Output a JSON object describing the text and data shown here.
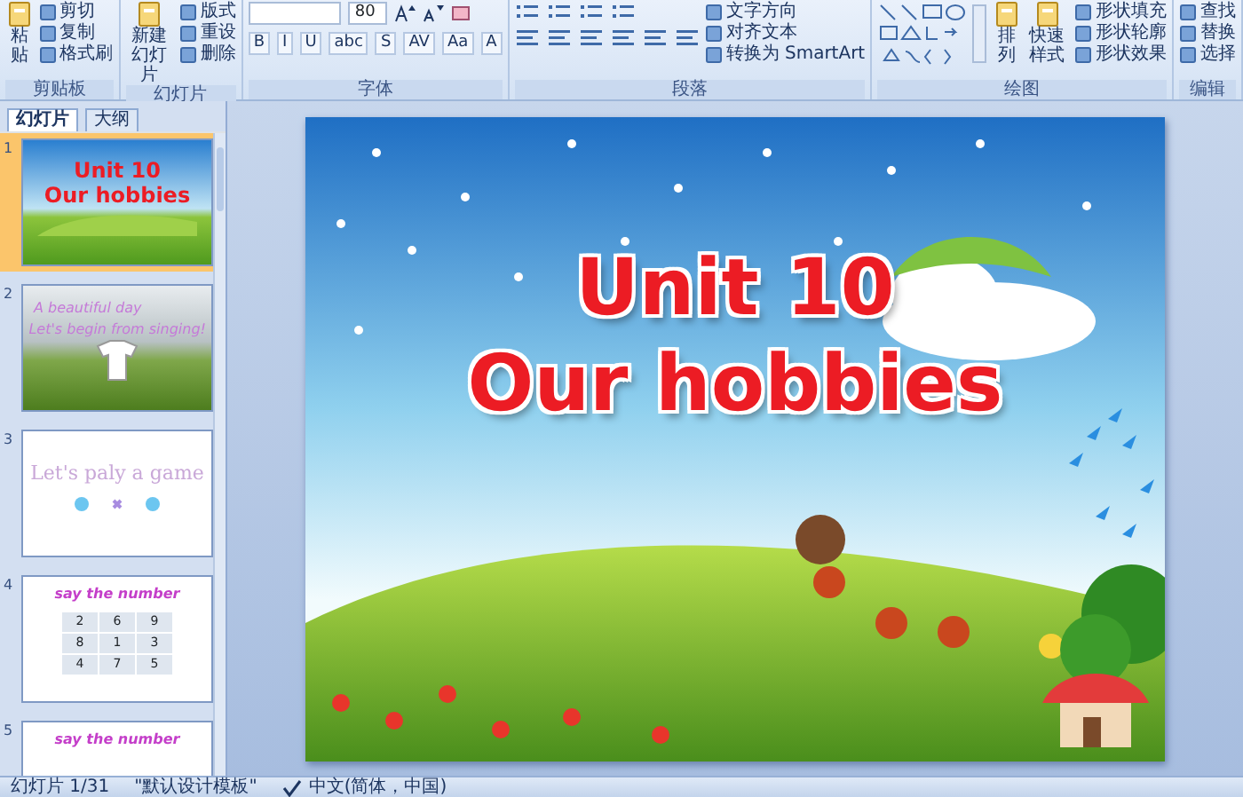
{
  "ribbon": {
    "groups": [
      {
        "label": "剪贴板",
        "columns": [
          [
            {
              "kind": "large",
              "label": "粘贴"
            }
          ],
          [
            {
              "kind": "small",
              "label": "剪切"
            },
            {
              "kind": "small",
              "label": "复制"
            },
            {
              "kind": "small",
              "label": "格式刷"
            }
          ]
        ]
      },
      {
        "label": "幻灯片",
        "columns": [
          [
            {
              "kind": "large",
              "label": "新建幻灯片"
            }
          ],
          [
            {
              "kind": "small",
              "label": "版式"
            },
            {
              "kind": "small",
              "label": "重设"
            },
            {
              "kind": "small",
              "label": "删除"
            }
          ]
        ]
      },
      {
        "label": "字体",
        "columns": [
          [
            {
              "kind": "fontbox",
              "size": "80"
            },
            {
              "kind": "glyphs",
              "glyphs": [
                "B",
                "I",
                "U",
                "abc",
                "S",
                "AV",
                "Aa",
                "A"
              ]
            }
          ]
        ]
      },
      {
        "label": "段落",
        "columns": [
          [
            {
              "kind": "list_icons"
            },
            {
              "kind": "align_icons"
            }
          ],
          [
            {
              "kind": "small",
              "label": "文字方向"
            },
            {
              "kind": "small",
              "label": "对齐文本"
            },
            {
              "kind": "small",
              "label": "转换为 SmartArt"
            }
          ]
        ]
      },
      {
        "label": "绘图",
        "columns": [
          [
            {
              "kind": "shapes"
            }
          ],
          [
            {
              "kind": "large",
              "label": "排列"
            }
          ],
          [
            {
              "kind": "large",
              "label": "快速样式"
            }
          ],
          [
            {
              "kind": "small",
              "label": "形状填充"
            },
            {
              "kind": "small",
              "label": "形状轮廓"
            },
            {
              "kind": "small",
              "label": "形状效果"
            }
          ]
        ]
      },
      {
        "label": "编辑",
        "columns": [
          [
            {
              "kind": "small",
              "label": "查找"
            },
            {
              "kind": "small",
              "label": "替换"
            },
            {
              "kind": "small",
              "label": "选择"
            }
          ]
        ]
      }
    ]
  },
  "panel": {
    "tabs": [
      {
        "label": "幻灯片",
        "selected": true
      },
      {
        "label": "大纲",
        "selected": false
      }
    ],
    "slides": [
      {
        "number": "1",
        "kind": "title",
        "selected": true,
        "lines": [
          "Unit 10",
          "Our hobbies"
        ]
      },
      {
        "number": "2",
        "kind": "photo",
        "selected": false,
        "lines": [
          "A beautiful day",
          "Let's begin from singing!"
        ]
      },
      {
        "number": "3",
        "kind": "game",
        "selected": false,
        "lines": [
          "Let's paly a game"
        ]
      },
      {
        "number": "4",
        "kind": "grid",
        "selected": false,
        "lines": [
          "say the number"
        ],
        "cells": [
          "2",
          "6",
          "9",
          "8",
          "1",
          "3",
          "4",
          "7",
          "5"
        ]
      },
      {
        "number": "5",
        "kind": "grid",
        "selected": false,
        "lines": [
          "say the number"
        ]
      }
    ]
  },
  "slide": {
    "title_lines": [
      "Unit 10",
      "Our hobbies"
    ]
  },
  "status_bar": {
    "slide_counter": "幻灯片 1/31",
    "theme": "\"默认设计模板\"",
    "language": "中文(简体，中国)"
  }
}
